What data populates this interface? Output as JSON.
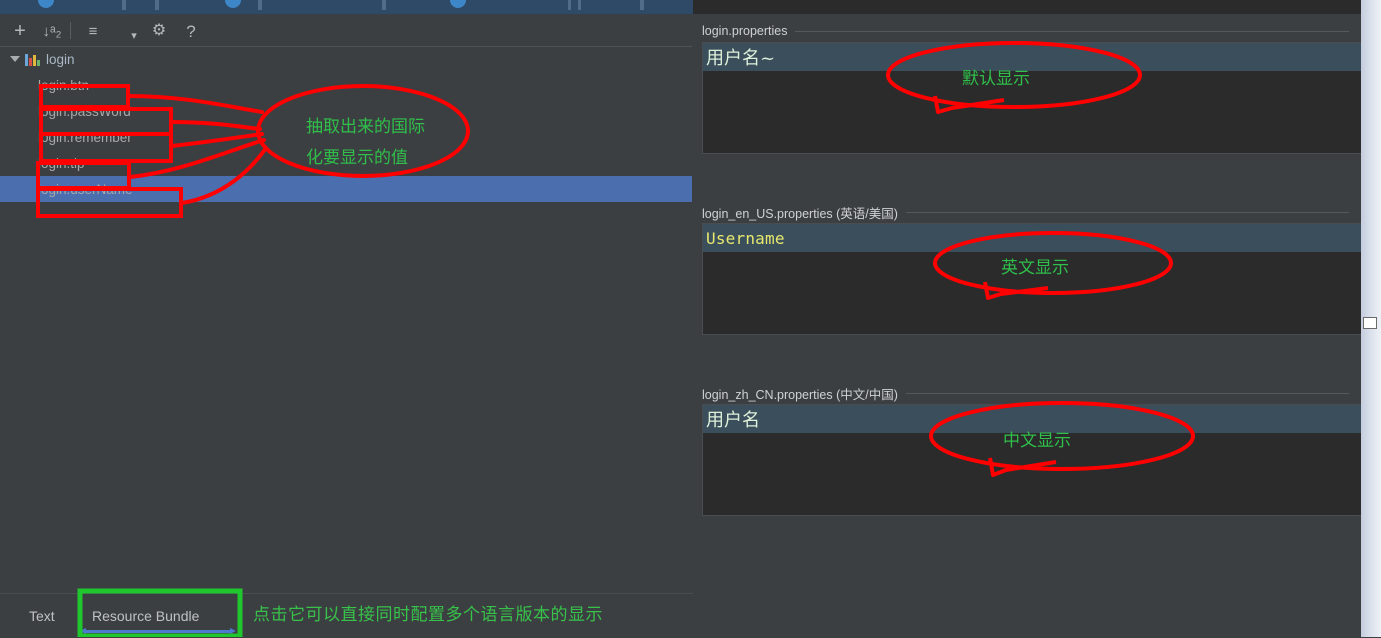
{
  "window": {
    "left_panel_bg": "#3c3f41",
    "editor_bg": "#2b2b2b",
    "selection_blue": "#4b6eaf",
    "value_row_bg": "#3a4e5c",
    "annotation_red": "#ff0000",
    "annotation_green": "#2fbf4a"
  },
  "toolbar": {
    "buttons": [
      {
        "name": "add",
        "glyph": "+",
        "title": "Add Property"
      },
      {
        "name": "sort-alphabetically",
        "glyph": "↓ᵃ₂",
        "title": "Sort"
      },
      {
        "name": "group-by-prefix",
        "glyph": "≡",
        "title": "Group"
      },
      {
        "name": "dropdown",
        "glyph": "▾",
        "title": "More"
      },
      {
        "name": "settings",
        "glyph": "⚙",
        "title": "Settings"
      },
      {
        "name": "help",
        "glyph": "?",
        "title": "Help"
      }
    ]
  },
  "tree": {
    "root": {
      "label": "login",
      "icon": "resource-bundle-icon",
      "expanded": true
    },
    "items": [
      {
        "label": "login.btn",
        "selected": false
      },
      {
        "label": "login.passWord",
        "selected": false
      },
      {
        "label": "login.remember",
        "selected": false
      },
      {
        "label": "login.tip",
        "selected": false
      },
      {
        "label": "login.userName",
        "selected": true
      }
    ]
  },
  "properties": [
    {
      "header": "login.properties",
      "value": "用户名~",
      "value_style": "cjk"
    },
    {
      "header": "login_en_US.properties (英语/美国)",
      "value": "Username",
      "value_style": "mono"
    },
    {
      "header": "login_zh_CN.properties (中文/中国)",
      "value": "用户名",
      "value_style": "cjk"
    }
  ],
  "bottom_tabs": {
    "tabs": [
      {
        "label": "Text",
        "active": false
      },
      {
        "label": "Resource Bundle",
        "active": true
      }
    ],
    "note": "点击它可以直接同时配置多个语言版本的显示"
  },
  "annotations": {
    "tree_callout_line1": "抽取出来的国际",
    "tree_callout_line2": "化要显示的值",
    "default_display": "默认显示",
    "english_display": "英文显示",
    "chinese_display": "中文显示"
  }
}
